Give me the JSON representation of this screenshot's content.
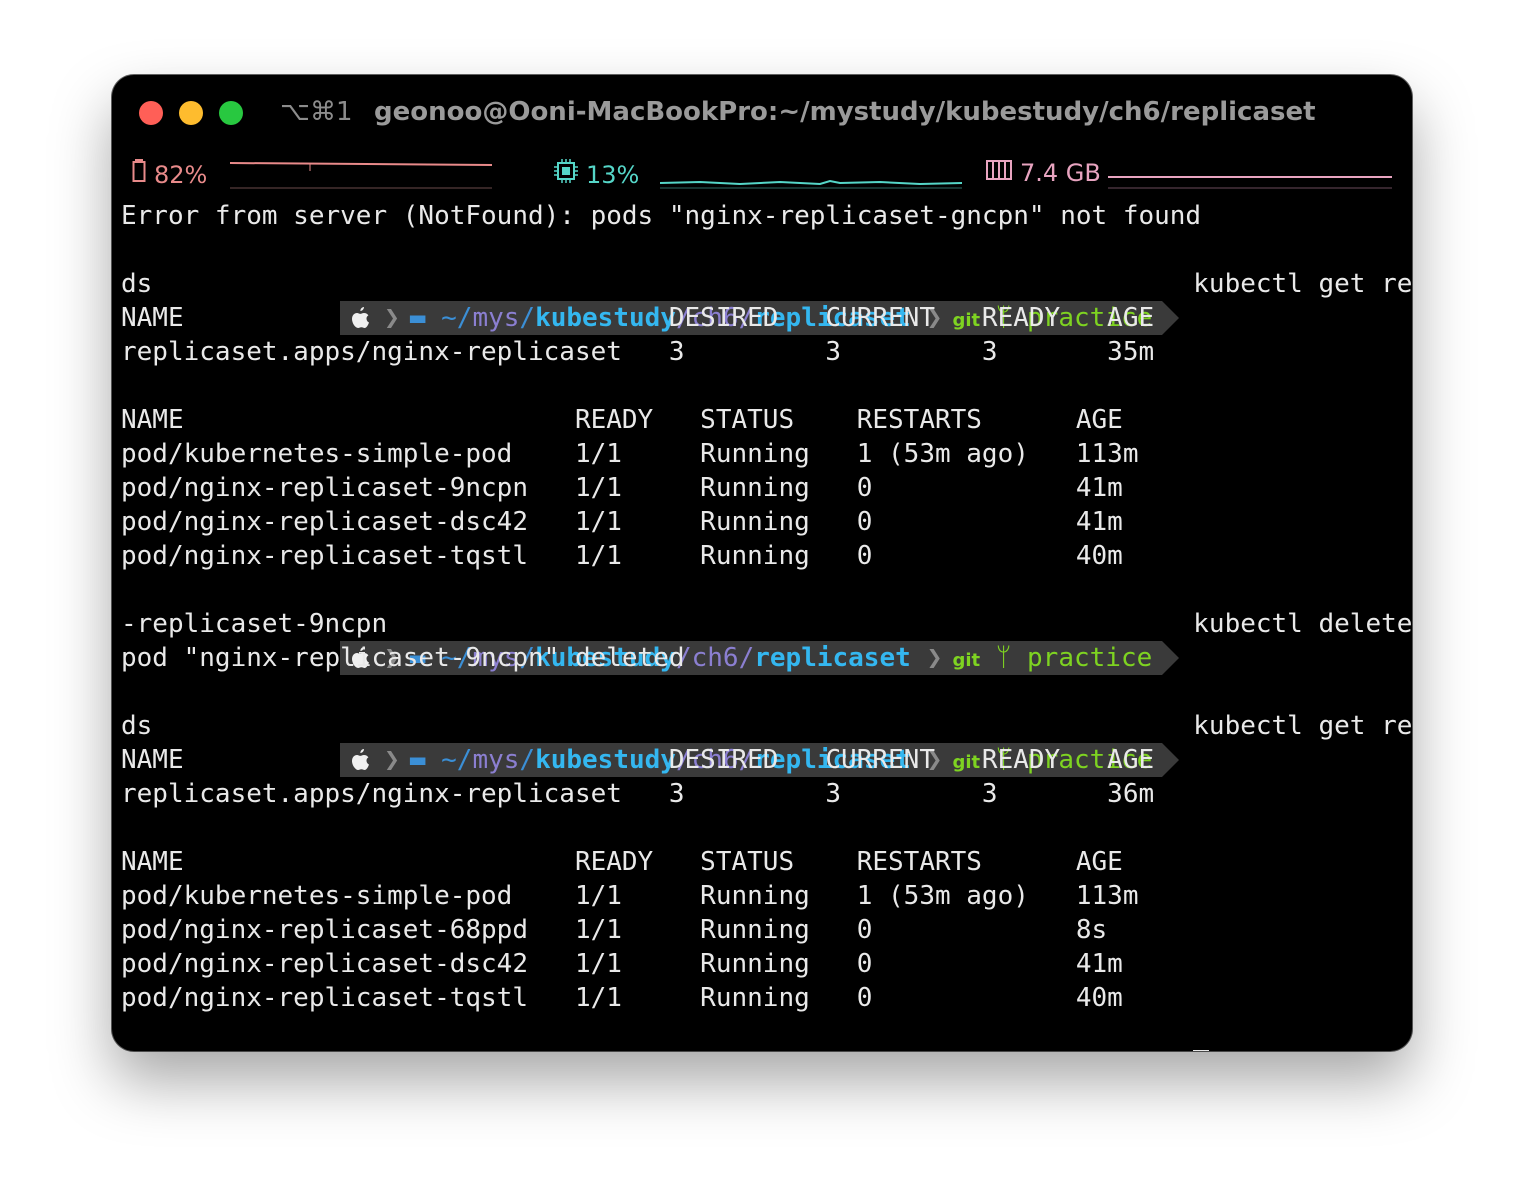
{
  "window": {
    "shortcut": "⌥⌘1",
    "title": "geonoo@Ooni-MacBookPro:~/mystudy/kubestudy/ch6/replicaset"
  },
  "status": {
    "battery": "82%",
    "cpu": "13%",
    "memory": "7.4 GB",
    "colors": {
      "battery": "#e88a8a",
      "cpu": "#55d6c8",
      "memory": "#e8a4c0"
    }
  },
  "prompt": {
    "apple_icon": "apple-icon",
    "folder_icon": "folder-icon",
    "path_home": "~/",
    "path_mys": "mys",
    "path_sep1": "/",
    "path_kubestudy": "kubestudy",
    "path_ch6": "/ch6/",
    "path_replicaset": "replicaset",
    "git_label": "git",
    "branch_icon": "git-branch-icon",
    "branch": "practice"
  },
  "lines": {
    "l01": "Error from server (NotFound): pods \"nginx-replicaset-gncpn\" not found",
    "cmd1": "kubectl get replicaset,po",
    "l03": "ds",
    "l04": "NAME                               DESIRED   CURRENT   READY   AGE",
    "l05": "replicaset.apps/nginx-replicaset   3         3         3       35m",
    "l06": "",
    "l07": "NAME                         READY   STATUS    RESTARTS      AGE",
    "l08": "pod/kubernetes-simple-pod    1/1     Running   1 (53m ago)   113m",
    "l09": "pod/nginx-replicaset-9ncpn   1/1     Running   0             41m",
    "l10": "pod/nginx-replicaset-dsc42   1/1     Running   0             41m",
    "l11": "pod/nginx-replicaset-tqstl   1/1     Running   0             40m",
    "cmd2": "kubectl delete pods nginx",
    "l13": "-replicaset-9ncpn",
    "l14": "pod \"nginx-replicaset-9ncpn\" deleted",
    "cmd3": "kubectl get replicaset,po",
    "l16": "ds",
    "l17": "NAME                               DESIRED   CURRENT   READY   AGE",
    "l18": "replicaset.apps/nginx-replicaset   3         3         3       36m",
    "l19": "",
    "l20": "NAME                         READY   STATUS    RESTARTS      AGE",
    "l21": "pod/kubernetes-simple-pod    1/1     Running   1 (53m ago)   113m",
    "l22": "pod/nginx-replicaset-68ppd   1/1     Running   0             8s",
    "l23": "pod/nginx-replicaset-dsc42   1/1     Running   0             41m",
    "l24": "pod/nginx-replicaset-tqstl   1/1     Running   0             40m"
  }
}
